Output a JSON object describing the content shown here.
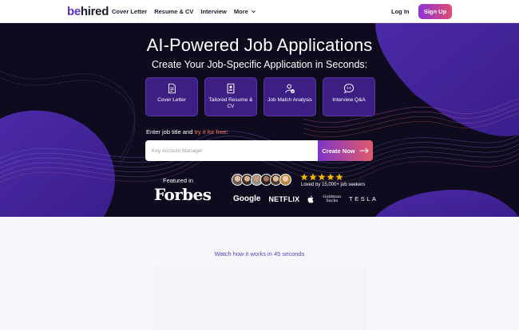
{
  "nav": {
    "logo_be": "be",
    "logo_hired": "hired",
    "links": [
      "Cover Letter",
      "Resume & CV",
      "Interview",
      "More"
    ],
    "login": "Log In",
    "signup": "Sign Up"
  },
  "hero": {
    "title": "AI-Powered Job Applications",
    "subtitle": "Create Your Job-Specific Application in Seconds:",
    "cards": [
      {
        "label": "Cover Letter",
        "icon": "document-icon"
      },
      {
        "label": "Tailored Resume & CV",
        "icon": "resume-icon"
      },
      {
        "label": "Job Match Analysis",
        "icon": "user-check-icon"
      },
      {
        "label": "Interview Q&A",
        "icon": "quote-bubble-icon"
      }
    ],
    "enter_label": "Enter job title and ",
    "try_label": "try it for free",
    "enter_colon": ":",
    "search_placeholder": "Key Account Manager",
    "create_button": "Create Now",
    "featured_label": "Featured in",
    "forbes": "Forbes",
    "loved": "Loved by 15,000+ job seekers",
    "brands": {
      "google": "Google",
      "netflix": "NETFLIX",
      "goldman_1": "Goldman",
      "goldman_2": "Sachs",
      "tesla": "TESLA"
    }
  },
  "section": {
    "watch": "Watch how it works in 45 seconds"
  },
  "colors": {
    "accent": "#5b2fc9",
    "hero_bg": "#0f0b1f",
    "card_bg": "#3d1e83",
    "cta_start": "#7d36c9",
    "cta_end": "#e2596b",
    "star": "#f5b800"
  }
}
